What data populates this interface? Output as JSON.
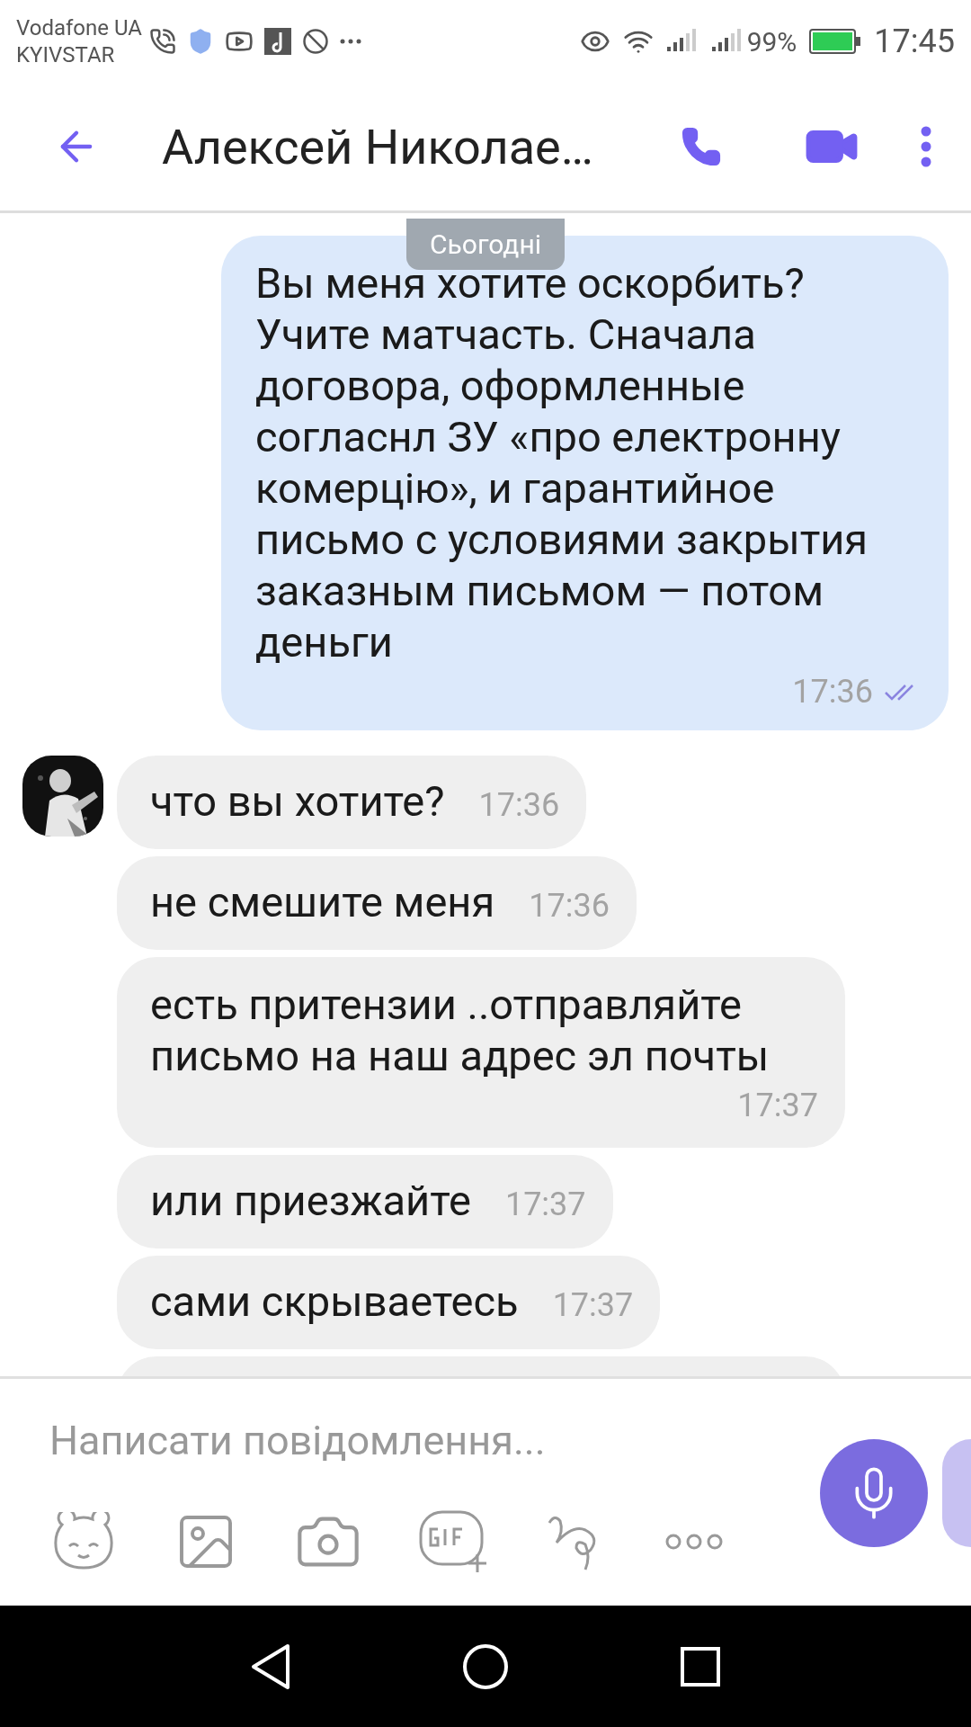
{
  "status_bar": {
    "carriers": [
      "Vodafone UA",
      "KYIVSTAR"
    ],
    "battery": "99%",
    "time": "17:45"
  },
  "header": {
    "title": "Алексей Николае…"
  },
  "date_label": "Сьогодні",
  "messages": [
    {
      "kind": "outgoing",
      "text": "Вы меня хотите оскорбить? Учите матчасть. Сначала договора, оформленные согласнл ЗУ «про електронну комерцію», и гарантийное письмо с условиями закрытия заказным письмом — потом деньги",
      "time": "17:36",
      "read": true
    },
    {
      "kind": "incoming",
      "text": "что вы хотите?",
      "time": "17:36",
      "time_below": false,
      "show_avatar": true
    },
    {
      "kind": "incoming",
      "text": "не смешите меня",
      "time": "17:36",
      "time_below": false,
      "show_avatar": false
    },
    {
      "kind": "incoming",
      "text": "есть притензии ..отправляйте письмо на наш адрес эл почты",
      "time": "17:37",
      "time_below": true,
      "show_avatar": false
    },
    {
      "kind": "incoming",
      "text": "или приезжайте",
      "time": "17:37",
      "time_below": false,
      "show_avatar": false
    },
    {
      "kind": "incoming",
      "text": "сами скрываетесь",
      "time": "17:37",
      "time_below": false,
      "show_avatar": false
    },
    {
      "kind": "partial"
    }
  ],
  "composer": {
    "placeholder": "Написати повідомлення..."
  }
}
